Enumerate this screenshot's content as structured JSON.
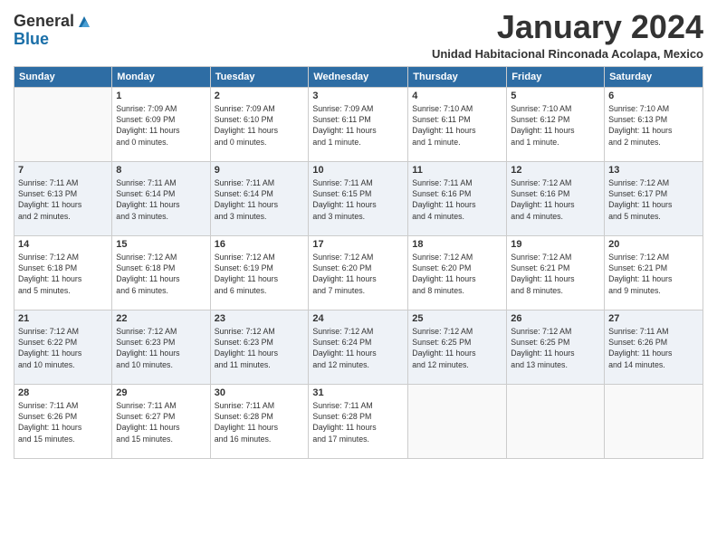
{
  "logo": {
    "general": "General",
    "blue": "Blue"
  },
  "header": {
    "month_title": "January 2024",
    "subtitle": "Unidad Habitacional Rinconada Acolapa, Mexico"
  },
  "days_of_week": [
    "Sunday",
    "Monday",
    "Tuesday",
    "Wednesday",
    "Thursday",
    "Friday",
    "Saturday"
  ],
  "weeks": [
    [
      {
        "num": "",
        "info": "",
        "empty": true
      },
      {
        "num": "1",
        "info": "Sunrise: 7:09 AM\nSunset: 6:09 PM\nDaylight: 11 hours\nand 0 minutes."
      },
      {
        "num": "2",
        "info": "Sunrise: 7:09 AM\nSunset: 6:10 PM\nDaylight: 11 hours\nand 0 minutes."
      },
      {
        "num": "3",
        "info": "Sunrise: 7:09 AM\nSunset: 6:11 PM\nDaylight: 11 hours\nand 1 minute."
      },
      {
        "num": "4",
        "info": "Sunrise: 7:10 AM\nSunset: 6:11 PM\nDaylight: 11 hours\nand 1 minute."
      },
      {
        "num": "5",
        "info": "Sunrise: 7:10 AM\nSunset: 6:12 PM\nDaylight: 11 hours\nand 1 minute."
      },
      {
        "num": "6",
        "info": "Sunrise: 7:10 AM\nSunset: 6:13 PM\nDaylight: 11 hours\nand 2 minutes."
      }
    ],
    [
      {
        "num": "7",
        "info": "Sunrise: 7:11 AM\nSunset: 6:13 PM\nDaylight: 11 hours\nand 2 minutes."
      },
      {
        "num": "8",
        "info": "Sunrise: 7:11 AM\nSunset: 6:14 PM\nDaylight: 11 hours\nand 3 minutes."
      },
      {
        "num": "9",
        "info": "Sunrise: 7:11 AM\nSunset: 6:14 PM\nDaylight: 11 hours\nand 3 minutes."
      },
      {
        "num": "10",
        "info": "Sunrise: 7:11 AM\nSunset: 6:15 PM\nDaylight: 11 hours\nand 3 minutes."
      },
      {
        "num": "11",
        "info": "Sunrise: 7:11 AM\nSunset: 6:16 PM\nDaylight: 11 hours\nand 4 minutes."
      },
      {
        "num": "12",
        "info": "Sunrise: 7:12 AM\nSunset: 6:16 PM\nDaylight: 11 hours\nand 4 minutes."
      },
      {
        "num": "13",
        "info": "Sunrise: 7:12 AM\nSunset: 6:17 PM\nDaylight: 11 hours\nand 5 minutes."
      }
    ],
    [
      {
        "num": "14",
        "info": "Sunrise: 7:12 AM\nSunset: 6:18 PM\nDaylight: 11 hours\nand 5 minutes."
      },
      {
        "num": "15",
        "info": "Sunrise: 7:12 AM\nSunset: 6:18 PM\nDaylight: 11 hours\nand 6 minutes."
      },
      {
        "num": "16",
        "info": "Sunrise: 7:12 AM\nSunset: 6:19 PM\nDaylight: 11 hours\nand 6 minutes."
      },
      {
        "num": "17",
        "info": "Sunrise: 7:12 AM\nSunset: 6:20 PM\nDaylight: 11 hours\nand 7 minutes."
      },
      {
        "num": "18",
        "info": "Sunrise: 7:12 AM\nSunset: 6:20 PM\nDaylight: 11 hours\nand 8 minutes."
      },
      {
        "num": "19",
        "info": "Sunrise: 7:12 AM\nSunset: 6:21 PM\nDaylight: 11 hours\nand 8 minutes."
      },
      {
        "num": "20",
        "info": "Sunrise: 7:12 AM\nSunset: 6:21 PM\nDaylight: 11 hours\nand 9 minutes."
      }
    ],
    [
      {
        "num": "21",
        "info": "Sunrise: 7:12 AM\nSunset: 6:22 PM\nDaylight: 11 hours\nand 10 minutes."
      },
      {
        "num": "22",
        "info": "Sunrise: 7:12 AM\nSunset: 6:23 PM\nDaylight: 11 hours\nand 10 minutes."
      },
      {
        "num": "23",
        "info": "Sunrise: 7:12 AM\nSunset: 6:23 PM\nDaylight: 11 hours\nand 11 minutes."
      },
      {
        "num": "24",
        "info": "Sunrise: 7:12 AM\nSunset: 6:24 PM\nDaylight: 11 hours\nand 12 minutes."
      },
      {
        "num": "25",
        "info": "Sunrise: 7:12 AM\nSunset: 6:25 PM\nDaylight: 11 hours\nand 12 minutes."
      },
      {
        "num": "26",
        "info": "Sunrise: 7:12 AM\nSunset: 6:25 PM\nDaylight: 11 hours\nand 13 minutes."
      },
      {
        "num": "27",
        "info": "Sunrise: 7:11 AM\nSunset: 6:26 PM\nDaylight: 11 hours\nand 14 minutes."
      }
    ],
    [
      {
        "num": "28",
        "info": "Sunrise: 7:11 AM\nSunset: 6:26 PM\nDaylight: 11 hours\nand 15 minutes."
      },
      {
        "num": "29",
        "info": "Sunrise: 7:11 AM\nSunset: 6:27 PM\nDaylight: 11 hours\nand 15 minutes."
      },
      {
        "num": "30",
        "info": "Sunrise: 7:11 AM\nSunset: 6:28 PM\nDaylight: 11 hours\nand 16 minutes."
      },
      {
        "num": "31",
        "info": "Sunrise: 7:11 AM\nSunset: 6:28 PM\nDaylight: 11 hours\nand 17 minutes."
      },
      {
        "num": "",
        "info": "",
        "empty": true
      },
      {
        "num": "",
        "info": "",
        "empty": true
      },
      {
        "num": "",
        "info": "",
        "empty": true
      }
    ]
  ]
}
